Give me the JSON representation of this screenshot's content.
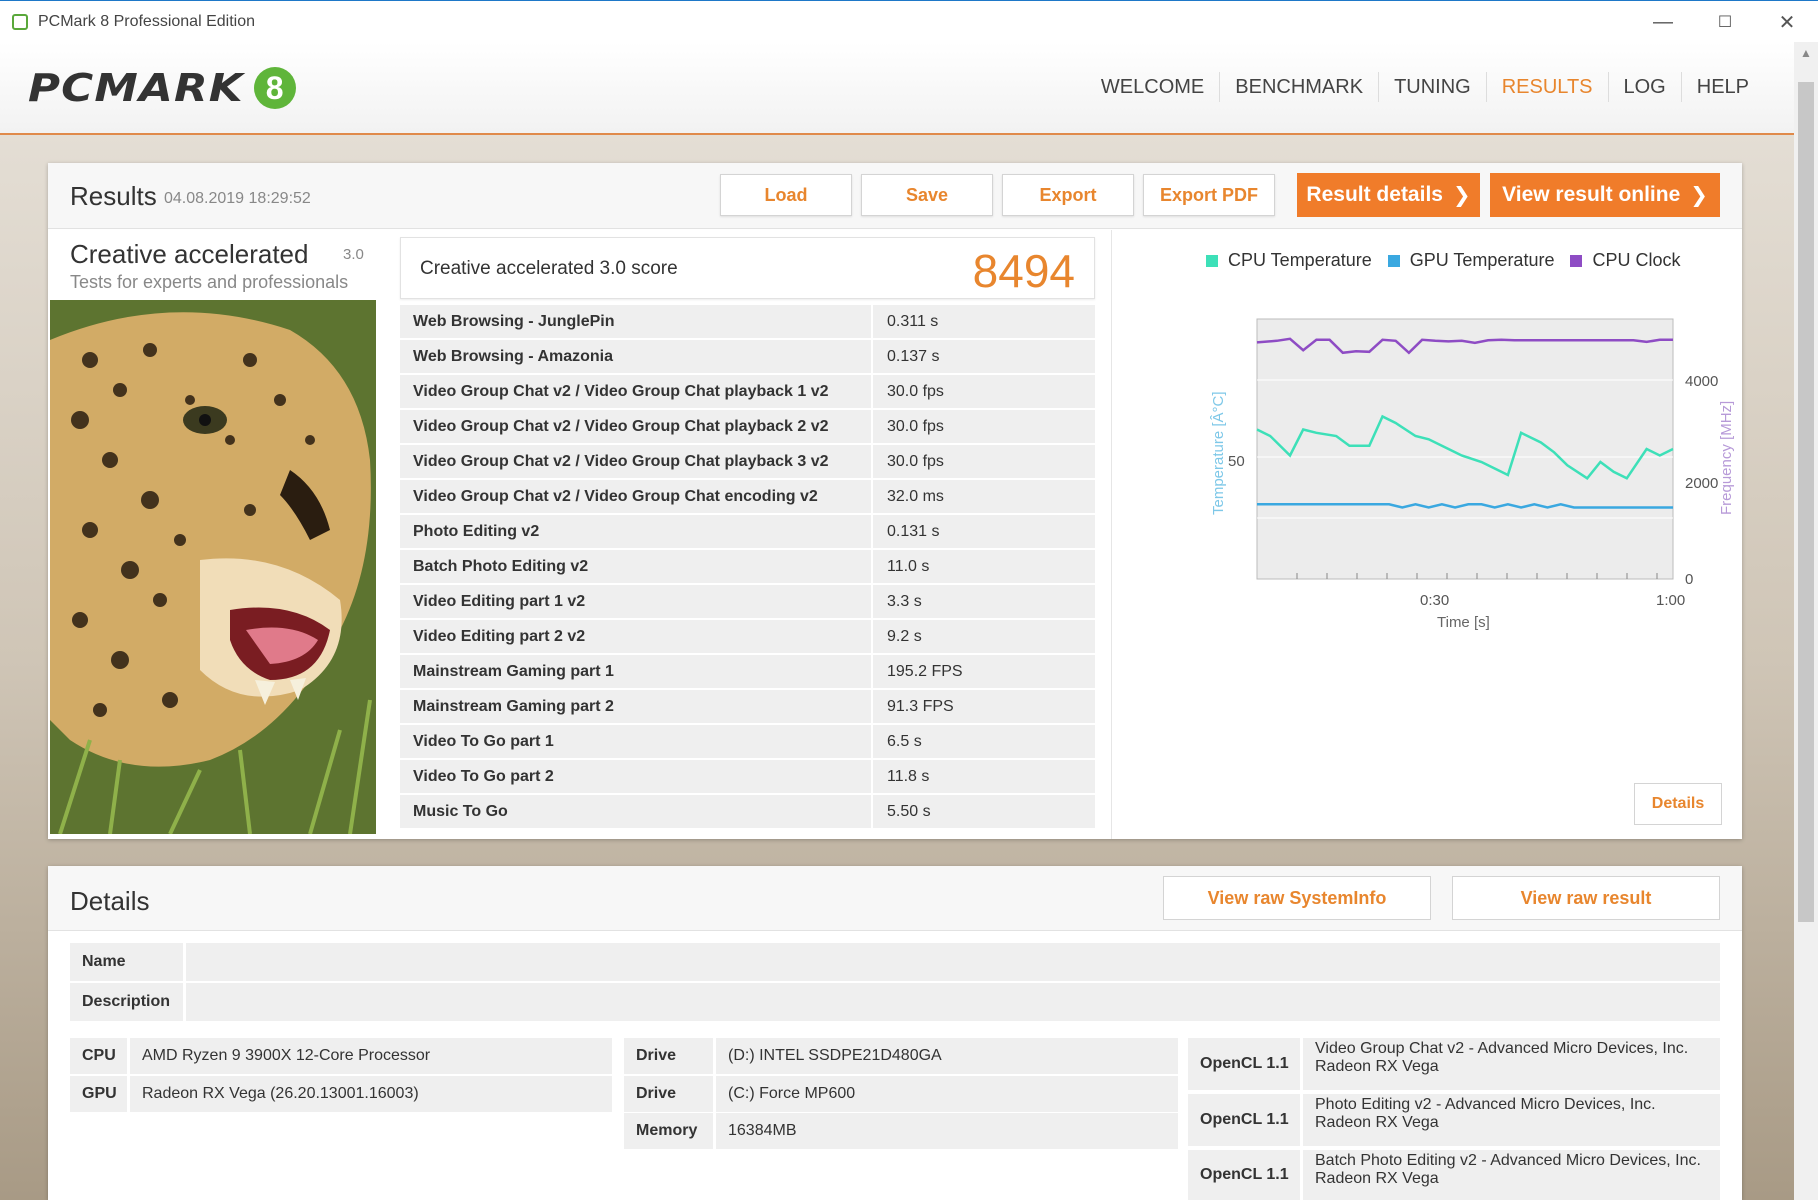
{
  "window": {
    "title": "PCMark 8 Professional Edition",
    "minimize": "—",
    "maximize": "☐",
    "close": "✕"
  },
  "logo": {
    "text": "PCMARK",
    "mark": "8"
  },
  "nav": {
    "items": [
      "WELCOME",
      "BENCHMARK",
      "TUNING",
      "RESULTS",
      "LOG",
      "HELP"
    ],
    "active": "RESULTS"
  },
  "results": {
    "title": "Results",
    "date": "04.08.2019 18:29:52",
    "buttons": {
      "load": "Load",
      "save": "Save",
      "export": "Export",
      "export_pdf": "Export PDF",
      "result_details": "Result details",
      "view_online": "View result online"
    },
    "preset": {
      "name": "Creative accelerated",
      "version": "3.0",
      "subtitle": "Tests for experts and professionals"
    },
    "score_label": "Creative accelerated 3.0 score",
    "score_value": "8494",
    "rows": [
      {
        "name": "Web Browsing - JunglePin",
        "value": "0.311 s"
      },
      {
        "name": "Web Browsing - Amazonia",
        "value": "0.137 s"
      },
      {
        "name": "Video Group Chat v2 / Video Group Chat playback 1 v2",
        "value": "30.0 fps"
      },
      {
        "name": "Video Group Chat v2 / Video Group Chat playback 2 v2",
        "value": "30.0 fps"
      },
      {
        "name": "Video Group Chat v2 / Video Group Chat playback 3 v2",
        "value": "30.0 fps"
      },
      {
        "name": "Video Group Chat v2 / Video Group Chat encoding v2",
        "value": "32.0 ms"
      },
      {
        "name": "Photo Editing v2",
        "value": "0.131 s"
      },
      {
        "name": "Batch Photo Editing v2",
        "value": "11.0 s"
      },
      {
        "name": "Video Editing part 1 v2",
        "value": "3.3 s"
      },
      {
        "name": "Video Editing part 2 v2",
        "value": "9.2 s"
      },
      {
        "name": "Mainstream Gaming part 1",
        "value": "195.2 FPS"
      },
      {
        "name": "Mainstream Gaming part 2",
        "value": "91.3 FPS"
      },
      {
        "name": "Video To Go part 1",
        "value": "6.5 s"
      },
      {
        "name": "Video To Go part 2",
        "value": "11.8 s"
      },
      {
        "name": "Music To Go",
        "value": "5.50 s"
      }
    ],
    "details_button": "Details"
  },
  "chart_data": {
    "type": "line",
    "legend": [
      "CPU Temperature",
      "GPU Temperature",
      "CPU Clock"
    ],
    "colors": {
      "cpu_temp": "#3de0b8",
      "gpu_temp": "#3aa8e0",
      "cpu_clock": "#8e4cc4"
    },
    "xlabel": "Time [s]",
    "ylabel_left": "Temperature [Â°C]",
    "ylabel_right": "Frequency [MHz]",
    "x_ticks": [
      "0:30",
      "1:00"
    ],
    "y_left_ticks": [
      "50"
    ],
    "y_right_ticks": [
      "4000",
      "2000",
      "0"
    ],
    "xlim": [
      0,
      63
    ],
    "ylim_left": [
      30,
      70
    ],
    "ylim_right": [
      0,
      5000
    ],
    "series": [
      {
        "name": "CPU Clock",
        "axis": "right",
        "x": [
          0,
          3,
          5,
          7,
          9,
          11,
          13,
          15,
          17,
          19,
          21,
          23,
          25,
          27,
          29,
          31,
          33,
          35,
          37,
          39,
          41,
          43,
          45,
          47,
          49,
          51,
          53,
          55,
          57,
          59,
          61,
          63
        ],
        "values": [
          4550,
          4580,
          4620,
          4400,
          4600,
          4600,
          4350,
          4380,
          4370,
          4600,
          4580,
          4350,
          4600,
          4580,
          4570,
          4580,
          4540,
          4590,
          4600,
          4590,
          4590,
          4590,
          4590,
          4590,
          4590,
          4590,
          4590,
          4590,
          4590,
          4560,
          4600,
          4600
        ]
      },
      {
        "name": "CPU Temperature",
        "axis": "left",
        "x": [
          0,
          2,
          5,
          7,
          9,
          12,
          14,
          17,
          19,
          21,
          24,
          26,
          29,
          31,
          34,
          36,
          38,
          40,
          43,
          45,
          47,
          50,
          52,
          54,
          56,
          59,
          61,
          63
        ],
        "values": [
          53,
          52,
          49,
          53,
          52.5,
          52,
          50.5,
          50.5,
          55,
          54,
          52,
          51.5,
          50,
          49,
          48,
          47,
          46,
          52.5,
          51,
          49.5,
          47.5,
          45.5,
          48,
          46.5,
          45.5,
          50,
          49,
          50
        ]
      },
      {
        "name": "GPU Temperature",
        "axis": "left",
        "x": [
          0,
          4,
          8,
          12,
          16,
          20,
          22,
          24,
          26,
          28,
          30,
          32,
          34,
          36,
          38,
          40,
          42,
          44,
          46,
          48,
          50,
          52,
          54,
          56,
          58,
          60,
          63
        ],
        "values": [
          41.5,
          41.5,
          41.5,
          41.5,
          41.5,
          41.5,
          41,
          41.5,
          41,
          41.5,
          41,
          41.5,
          41.5,
          41,
          41.5,
          41,
          41.5,
          41,
          41.5,
          41,
          41,
          41,
          41,
          41,
          41,
          41,
          41
        ]
      }
    ]
  },
  "details": {
    "title": "Details",
    "buttons": {
      "view_sysinfo": "View raw SystemInfo",
      "view_raw_result": "View raw result"
    },
    "name_label": "Name",
    "description_label": "Description",
    "cpu_label": "CPU",
    "cpu_value": "AMD Ryzen 9 3900X 12-Core Processor",
    "gpu_label": "GPU",
    "gpu_value": "Radeon RX Vega (26.20.13001.16003)",
    "drive1_label": "Drive",
    "drive1_value": "(D:) INTEL SSDPE21D480GA",
    "drive2_label": "Drive",
    "drive2_value": "(C:) Force MP600",
    "memory_label": "Memory",
    "memory_value": "16384MB",
    "opencl": [
      {
        "label": "OpenCL 1.1",
        "line1": "Video Group Chat v2 - Advanced Micro Devices, Inc.",
        "line2": "Radeon RX Vega"
      },
      {
        "label": "OpenCL 1.1",
        "line1": "Photo Editing v2 - Advanced Micro Devices, Inc.",
        "line2": "Radeon RX Vega"
      },
      {
        "label": "OpenCL 1.1",
        "line1": "Batch Photo Editing v2 - Advanced Micro Devices, Inc.",
        "line2": "Radeon RX Vega"
      }
    ]
  }
}
